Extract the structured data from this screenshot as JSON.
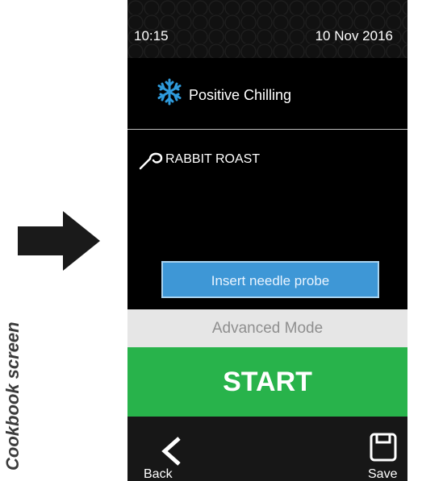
{
  "caption": "Cookbook screen",
  "status": {
    "time": "10:15",
    "date": "10 Nov 2016"
  },
  "mode": {
    "label": "Positive Chilling",
    "icon": "snowflake-icon",
    "icon_color": "#2f9bdc"
  },
  "recipe": {
    "name": "RABBIT ROAST",
    "icon": "probe-hook-icon"
  },
  "buttons": {
    "insert_probe": "Insert needle probe",
    "advanced_mode": "Advanced Mode",
    "start": "START",
    "back": "Back",
    "save": "Save"
  },
  "colors": {
    "start_bg": "#28b34b",
    "insert_bg": "#3e97d6",
    "advanced_bg": "#e6e6e6",
    "screen_bg": "#000000"
  }
}
